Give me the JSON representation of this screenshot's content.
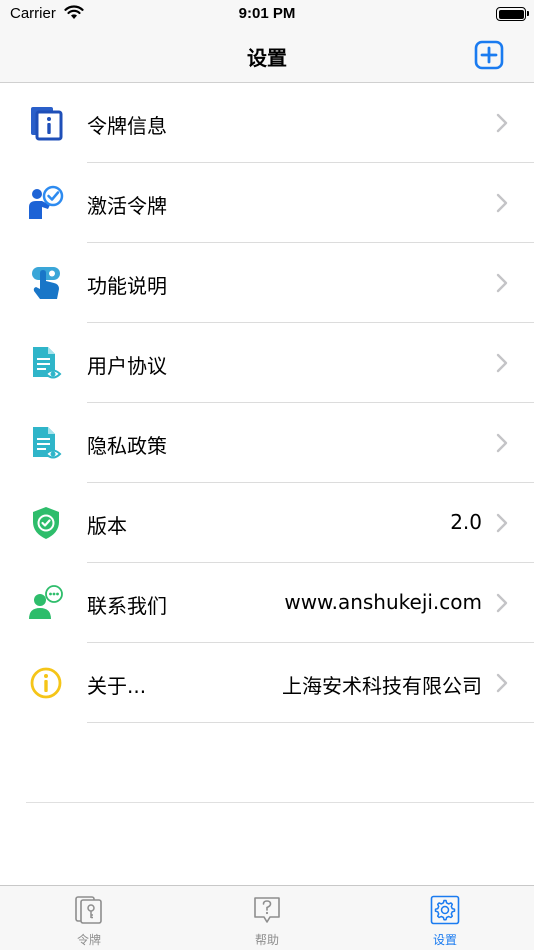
{
  "status_bar": {
    "carrier": "Carrier",
    "time": "9:01 PM"
  },
  "nav": {
    "title": "设置",
    "add_icon": "plus-square-icon"
  },
  "items": [
    {
      "label": "令牌信息",
      "value": "",
      "icon": "token-info-icon"
    },
    {
      "label": "激活令牌",
      "value": "",
      "icon": "activate-user-icon"
    },
    {
      "label": "功能说明",
      "value": "",
      "icon": "tap-hand-icon"
    },
    {
      "label": "用户协议",
      "value": "",
      "icon": "document-view-icon"
    },
    {
      "label": "隐私政策",
      "value": "",
      "icon": "document-view-icon"
    },
    {
      "label": "版本",
      "value": "2.0",
      "icon": "shield-check-icon"
    },
    {
      "label": "联系我们",
      "value": "www.anshukeji.com",
      "icon": "contact-chat-icon"
    },
    {
      "label": "关于...",
      "value": "上海安术科技有限公司",
      "icon": "info-circle-icon"
    }
  ],
  "tabs": [
    {
      "label": "令牌",
      "icon": "token-tab-icon",
      "active": false
    },
    {
      "label": "帮助",
      "icon": "help-tab-icon",
      "active": false
    },
    {
      "label": "设置",
      "icon": "gear-tab-icon",
      "active": true
    }
  ],
  "colors": {
    "accent": "#1a7bf0",
    "inactive": "#8e8e8e",
    "green": "#2ebd6b",
    "yellow": "#f5c518"
  }
}
